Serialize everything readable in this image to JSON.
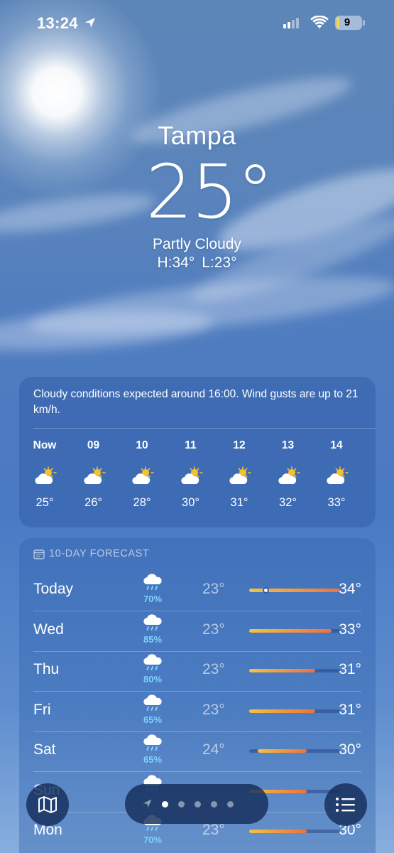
{
  "status_bar": {
    "time": "13:24",
    "battery": "9"
  },
  "header": {
    "city": "Tampa",
    "temperature": "25°",
    "condition": "Partly Cloudy",
    "high": "H:34°",
    "low": "L:23°"
  },
  "hourly": {
    "summary": "Cloudy conditions expected around 16:00. Wind gusts are up to 21 km/h.",
    "hours": [
      {
        "label": "Now",
        "icon": "partly-cloudy-icon",
        "temp": "25°"
      },
      {
        "label": "09",
        "icon": "partly-cloudy-icon",
        "temp": "26°"
      },
      {
        "label": "10",
        "icon": "partly-cloudy-icon",
        "temp": "28°"
      },
      {
        "label": "11",
        "icon": "partly-cloudy-icon",
        "temp": "30°"
      },
      {
        "label": "12",
        "icon": "partly-cloudy-icon",
        "temp": "31°"
      },
      {
        "label": "13",
        "icon": "partly-cloudy-icon",
        "temp": "32°"
      },
      {
        "label": "14",
        "icon": "partly-cloudy-icon",
        "temp": "33°"
      }
    ]
  },
  "forecast": {
    "title": "10-DAY FORECAST",
    "scale": {
      "min": 23,
      "max": 34
    },
    "days": [
      {
        "day": "Today",
        "icon": "rain-cloud-icon",
        "precip": "70%",
        "low": "23°",
        "high": "34°",
        "low_value": 23,
        "high_value": 34,
        "current_value": 25
      },
      {
        "day": "Wed",
        "icon": "rain-cloud-icon",
        "precip": "85%",
        "low": "23°",
        "high": "33°",
        "low_value": 23,
        "high_value": 33
      },
      {
        "day": "Thu",
        "icon": "rain-cloud-icon",
        "precip": "80%",
        "low": "23°",
        "high": "31°",
        "low_value": 23,
        "high_value": 31
      },
      {
        "day": "Fri",
        "icon": "rain-cloud-icon",
        "precip": "65%",
        "low": "23°",
        "high": "31°",
        "low_value": 23,
        "high_value": 31
      },
      {
        "day": "Sat",
        "icon": "rain-cloud-icon",
        "precip": "65%",
        "low": "24°",
        "high": "30°",
        "low_value": 24,
        "high_value": 30
      },
      {
        "day": "Sun",
        "icon": "rain-cloud-icon",
        "precip": "",
        "low": "",
        "high": "",
        "low_value": 23,
        "high_value": 30
      },
      {
        "day": "Mon",
        "icon": "rain-cloud-icon",
        "precip": "70%",
        "low": "23°",
        "high": "30°",
        "low_value": 23,
        "high_value": 30
      }
    ]
  },
  "bottom_bar": {
    "page_count": 5,
    "active_page": 0
  },
  "colors": {
    "accent_rain": "#7fd1ff",
    "sun": "#f6c12f"
  }
}
